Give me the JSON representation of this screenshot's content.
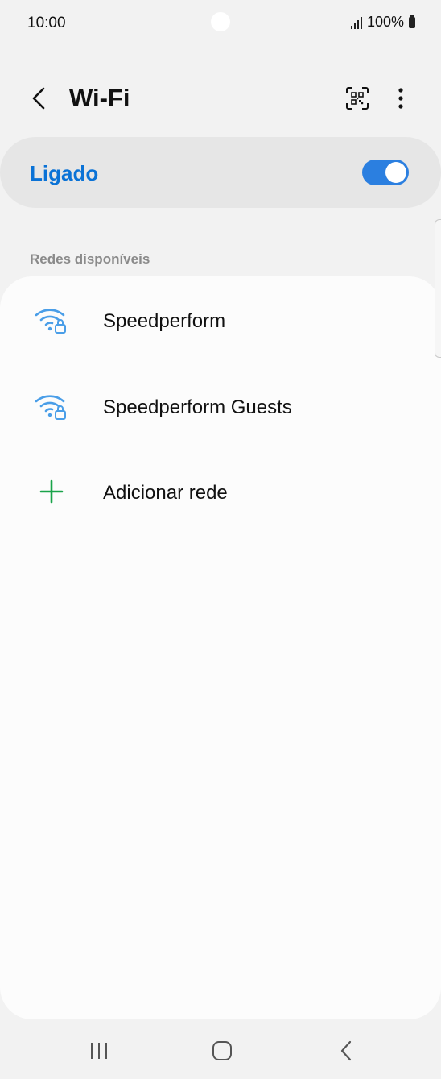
{
  "status_bar": {
    "time": "10:00",
    "battery_text": "100%"
  },
  "header": {
    "title": "Wi-Fi"
  },
  "master_toggle": {
    "label": "Ligado",
    "enabled": true,
    "color": "#0a72d6"
  },
  "networks": {
    "section_title": "Redes disponíveis",
    "items": [
      {
        "name": "Speedperform",
        "icon": "wifi-secure-icon"
      },
      {
        "name": "Speedperform Guests",
        "icon": "wifi-secure-icon"
      }
    ],
    "add_label": "Adicionar rede"
  },
  "colors": {
    "accent": "#2b7fe0",
    "wifi_icon": "#4a9ee8",
    "add_icon": "#1aa34a"
  }
}
